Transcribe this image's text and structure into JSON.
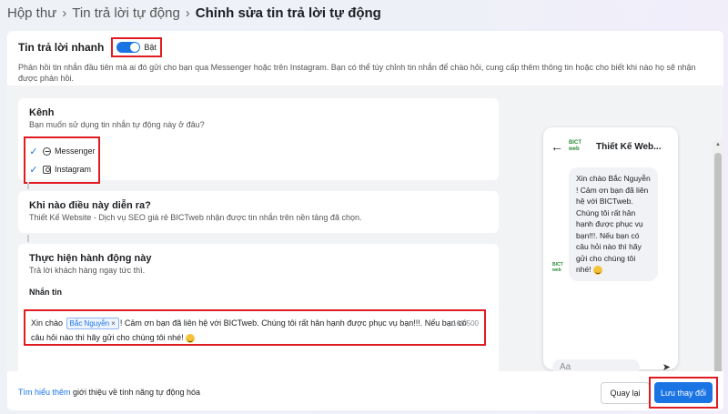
{
  "breadcrumb": {
    "items": [
      "Hộp thư",
      "Tin trả lời tự động"
    ],
    "current": "Chỉnh sửa tin trả lời tự động"
  },
  "quick_reply": {
    "title": "Tin trả lời nhanh",
    "toggle_label": "Bật",
    "toggle_on": true,
    "description": "Phản hồi tin nhắn đầu tiên mà ai đó gửi cho bạn qua Messenger hoặc trên Instagram. Bạn có thể tùy chỉnh tin nhắn để chào hỏi, cung cấp thêm thông tin hoặc cho biết khi nào họ sẽ nhận được phản hồi."
  },
  "channel": {
    "title": "Kênh",
    "subtitle": "Bạn muốn sử dụng tin nhắn tự động này ở đâu?",
    "options": [
      {
        "label": "Messenger",
        "checked": true,
        "icon": "messenger-icon"
      },
      {
        "label": "Instagram",
        "checked": true,
        "icon": "instagram-icon"
      }
    ]
  },
  "trigger": {
    "title": "Khi nào điều này diễn ra?",
    "subtitle": "Thiết Kế Website - Dịch vụ SEO giá rẻ BICTweb nhận được tin nhắn trên nền tảng đã chọn."
  },
  "action": {
    "title": "Thực hiện hành động này",
    "subtitle": "Trả lời khách hàng ngay tức thì.",
    "message_label": "Nhắn tin",
    "message_prefix": "Xin chào",
    "tag_label": "Bắc Nguyễn",
    "message_body": "! Cảm ơn bạn đã liên hệ với BICTweb. Chúng tôi rất hân hạnh được phục vụ bạn!!!. Nếu bạn có câu hỏi nào thì hãy gửi cho chúng tôi nhé!",
    "char_count": "166/500"
  },
  "preview": {
    "page_name": "Thiết Kế Web...",
    "logo_text": "BICT web",
    "bubble_text": "Xin chào Bắc Nguyễn ! Cảm ơn bạn đã liên hệ với BICTweb. Chúng tôi rất hân hạnh được phục vụ bạn!!!. Nếu bạn có câu hỏi nào thì hãy gửi cho chúng tôi nhé!",
    "input_placeholder": "Aa"
  },
  "footer": {
    "link_text": "Tìm hiểu thêm",
    "rest_text": " giới thiệu về tính năng tự động hóa",
    "back_label": "Quay lại",
    "save_label": "Lưu thay đổi"
  },
  "colors": {
    "accent": "#1b74e4",
    "highlight": "#e11b22"
  }
}
